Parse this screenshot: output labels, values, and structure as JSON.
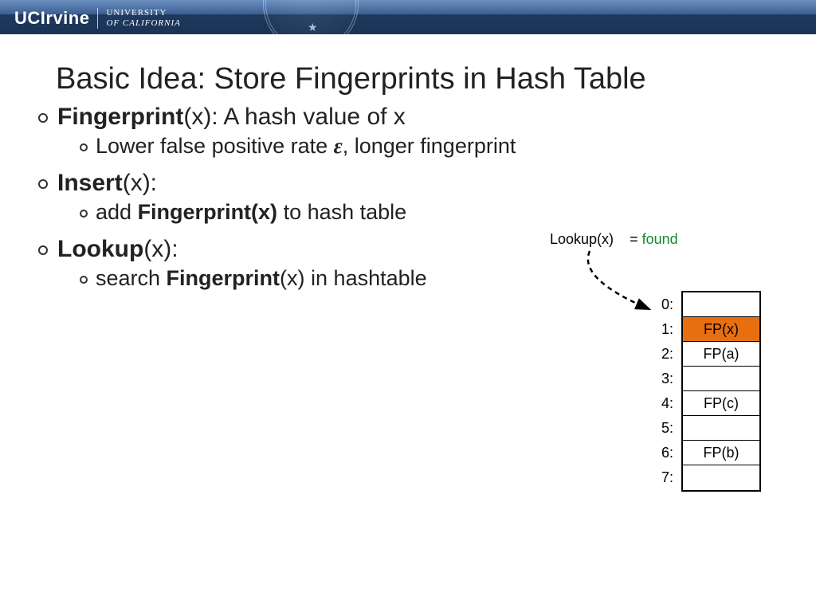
{
  "header": {
    "logo_main": "UCIrvine",
    "logo_sub1": "UNIVERSITY",
    "logo_sub2": "OF CALIFORNIA"
  },
  "title": "Basic Idea: Store Fingerprints in Hash Table",
  "bullets": {
    "b1_bold": "Fingerprint",
    "b1_rest": "(x): A hash value of x",
    "b1a_pre": "Lower false positive rate ",
    "b1a_eps": "ε",
    "b1a_post": ", longer fingerprint",
    "b2_bold": "Insert",
    "b2_rest": "(x):",
    "b2a_pre": "add ",
    "b2a_bold": "Fingerprint(x)",
    "b2a_post": " to hash table",
    "b3_bold": "Lookup",
    "b3_rest": "(x):",
    "b3a_pre": "search ",
    "b3a_bold": "Fingerprint",
    "b3a_post": "(x) in hashtable"
  },
  "diagram": {
    "lookup_label": "Lookup(x)",
    "result_prefix": "= ",
    "result": "found",
    "indices": [
      "0:",
      "1:",
      "2:",
      "3:",
      "4:",
      "5:",
      "6:",
      "7:"
    ],
    "cells": [
      "",
      "FP(x)",
      "FP(a)",
      "",
      "FP(c)",
      "",
      "FP(b)",
      ""
    ],
    "highlight_index": 1
  }
}
